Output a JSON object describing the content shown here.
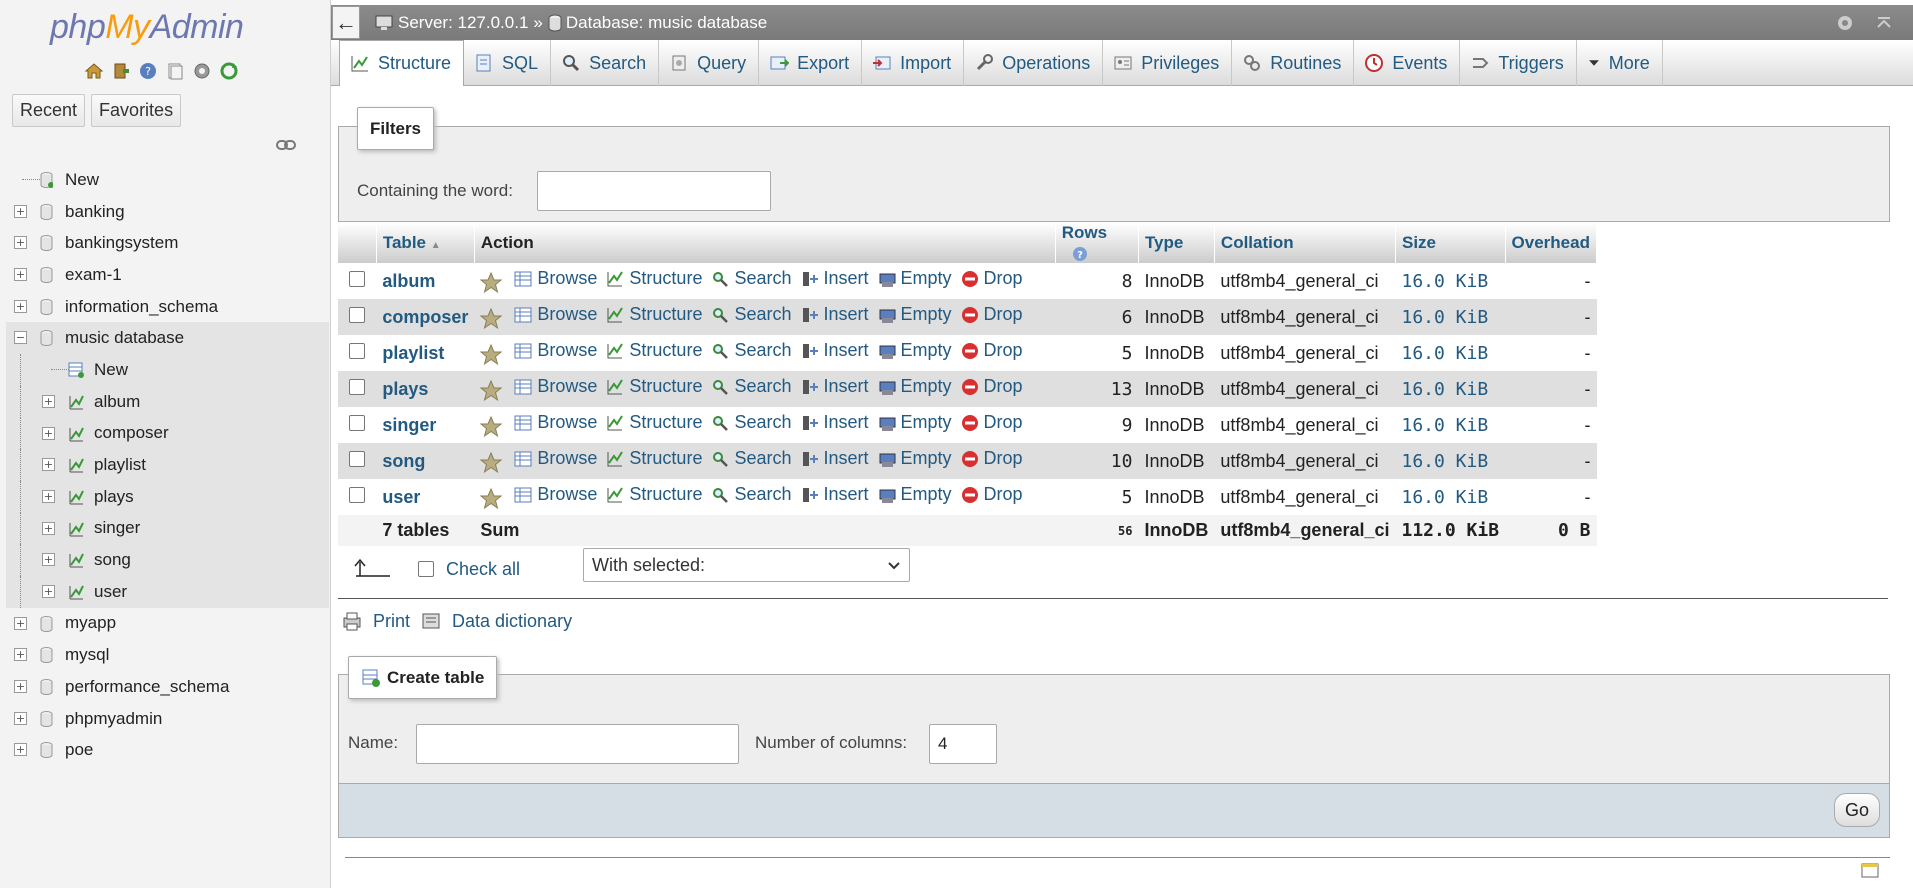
{
  "nav": {
    "logo": {
      "php": "php",
      "my": "My",
      "admin": "Admin"
    },
    "quick_icons": [
      "home-icon",
      "logout-icon",
      "help-icon",
      "docs-icon",
      "settings-icon",
      "reload-icon"
    ],
    "recent_label": "Recent",
    "favorites_label": "Favorites",
    "tree": {
      "new_label": "New",
      "databases_before": [
        "banking",
        "bankingsystem",
        "exam-1",
        "information_schema"
      ],
      "current_db": "music database",
      "current_children": [
        "New",
        "album",
        "composer",
        "playlist",
        "plays",
        "singer",
        "song",
        "user"
      ],
      "databases_after": [
        "myapp",
        "mysql",
        "performance_schema",
        "phpmyadmin",
        "poe"
      ]
    }
  },
  "breadcrumb": {
    "back": "←",
    "server": "Server: 127.0.0.1",
    "separator": "»",
    "database": "Database: music database"
  },
  "tabs": [
    "Structure",
    "SQL",
    "Search",
    "Query",
    "Export",
    "Import",
    "Operations",
    "Privileges",
    "Routines",
    "Events",
    "Triggers",
    "More"
  ],
  "filters": {
    "legend": "Filters",
    "label": "Containing the word:",
    "value": ""
  },
  "table": {
    "headers": {
      "table": "Table",
      "action": "Action",
      "rows": "Rows",
      "type": "Type",
      "collation": "Collation",
      "size": "Size",
      "overhead": "Overhead"
    },
    "actions": [
      "Browse",
      "Structure",
      "Search",
      "Insert",
      "Empty",
      "Drop"
    ],
    "rows": [
      {
        "name": "album",
        "rows": "8",
        "type": "InnoDB",
        "collation": "utf8mb4_general_ci",
        "size": "16.0 KiB",
        "overhead": "-"
      },
      {
        "name": "composer",
        "rows": "6",
        "type": "InnoDB",
        "collation": "utf8mb4_general_ci",
        "size": "16.0 KiB",
        "overhead": "-"
      },
      {
        "name": "playlist",
        "rows": "5",
        "type": "InnoDB",
        "collation": "utf8mb4_general_ci",
        "size": "16.0 KiB",
        "overhead": "-"
      },
      {
        "name": "plays",
        "rows": "13",
        "type": "InnoDB",
        "collation": "utf8mb4_general_ci",
        "size": "16.0 KiB",
        "overhead": "-"
      },
      {
        "name": "singer",
        "rows": "9",
        "type": "InnoDB",
        "collation": "utf8mb4_general_ci",
        "size": "16.0 KiB",
        "overhead": "-"
      },
      {
        "name": "song",
        "rows": "10",
        "type": "InnoDB",
        "collation": "utf8mb4_general_ci",
        "size": "16.0 KiB",
        "overhead": "-"
      },
      {
        "name": "user",
        "rows": "5",
        "type": "InnoDB",
        "collation": "utf8mb4_general_ci",
        "size": "16.0 KiB",
        "overhead": "-"
      }
    ],
    "footer": {
      "count": "7 tables",
      "sum": "Sum",
      "rows": "56",
      "type": "InnoDB",
      "collation": "utf8mb4_general_ci",
      "size": "112.0 KiB",
      "overhead": "0 B"
    }
  },
  "bulk": {
    "check_all": "Check all",
    "with_selected": "With selected:"
  },
  "print_label": "Print",
  "data_dictionary_label": "Data dictionary",
  "create": {
    "legend": "Create table",
    "name_label": "Name:",
    "name_value": "",
    "columns_label": "Number of columns:",
    "columns_value": "4",
    "go": "Go"
  },
  "colors": {
    "link": "#235a81",
    "topbar": "#838383",
    "accent_orange": "#f89c0e"
  }
}
